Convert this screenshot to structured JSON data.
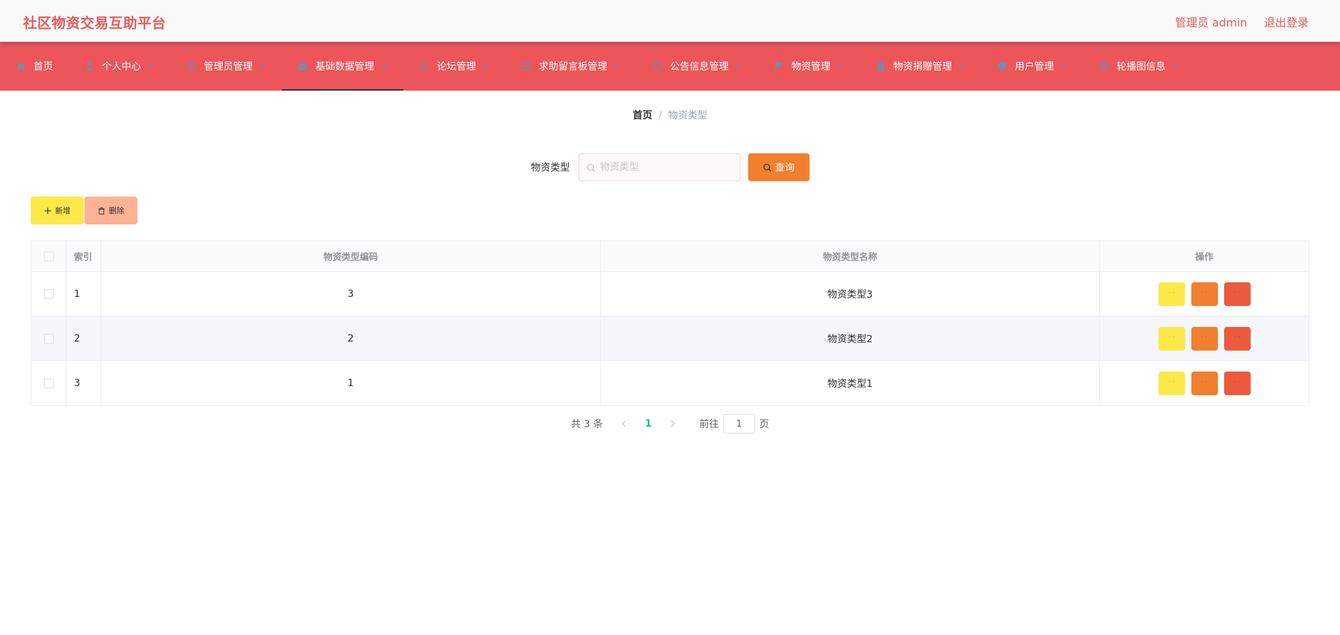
{
  "app": {
    "title": "社区物资交易互助平台"
  },
  "header": {
    "user_label": "管理员 admin",
    "logout_label": "退出登录"
  },
  "nav": {
    "items": [
      {
        "label": "首页",
        "icon": "home-icon",
        "has_menu": false,
        "active": false
      },
      {
        "label": "个人中心",
        "icon": "user-icon",
        "has_menu": true,
        "active": false
      },
      {
        "label": "管理员管理",
        "icon": "compass-icon",
        "has_menu": true,
        "active": false
      },
      {
        "label": "基础数据管理",
        "icon": "briefcase-icon",
        "has_menu": true,
        "active": true
      },
      {
        "label": "论坛管理",
        "icon": "power-icon",
        "has_menu": true,
        "active": false
      },
      {
        "label": "求助留言板管理",
        "icon": "message-icon",
        "has_menu": true,
        "active": false
      },
      {
        "label": "公告信息管理",
        "icon": "aim-icon",
        "has_menu": true,
        "active": false
      },
      {
        "label": "物资管理",
        "icon": "flag-icon",
        "has_menu": true,
        "active": false
      },
      {
        "label": "物资捐赠管理",
        "icon": "clipboard-icon",
        "has_menu": true,
        "active": false
      },
      {
        "label": "用户管理",
        "icon": "monitor-icon",
        "has_menu": true,
        "active": false
      },
      {
        "label": "轮播图信息",
        "icon": "help-circle-icon",
        "has_menu": true,
        "active": false
      }
    ]
  },
  "breadcrumb": {
    "home": "首页",
    "separator": "/",
    "current": "物资类型"
  },
  "search": {
    "label": "物资类型",
    "placeholder": "物资类型",
    "value": "",
    "button_label": "查询"
  },
  "actions": {
    "add_label": "新增",
    "delete_label": "删除"
  },
  "table": {
    "headers": {
      "index": "索引",
      "code": "物资类型编码",
      "name": "物资类型名称",
      "ops": "操作"
    },
    "rows": [
      {
        "index": "1",
        "code": "3",
        "name": "物资类型3"
      },
      {
        "index": "2",
        "code": "2",
        "name": "物资类型2"
      },
      {
        "index": "3",
        "code": "1",
        "name": "物资类型1"
      }
    ]
  },
  "pagination": {
    "total_text": "共 3 条",
    "current_page": "1",
    "goto_label": "前往",
    "goto_value": "1",
    "page_suffix": "页"
  },
  "colors": {
    "brand": "#ec5559",
    "title": "#e85a5a",
    "query": "#f27f2f",
    "add": "#fde84a",
    "delete": "#fdb293",
    "op_edit": "#fde84a",
    "op_view": "#f27f2f",
    "op_remove": "#ec5a3e",
    "page_active": "#1abc9c"
  }
}
